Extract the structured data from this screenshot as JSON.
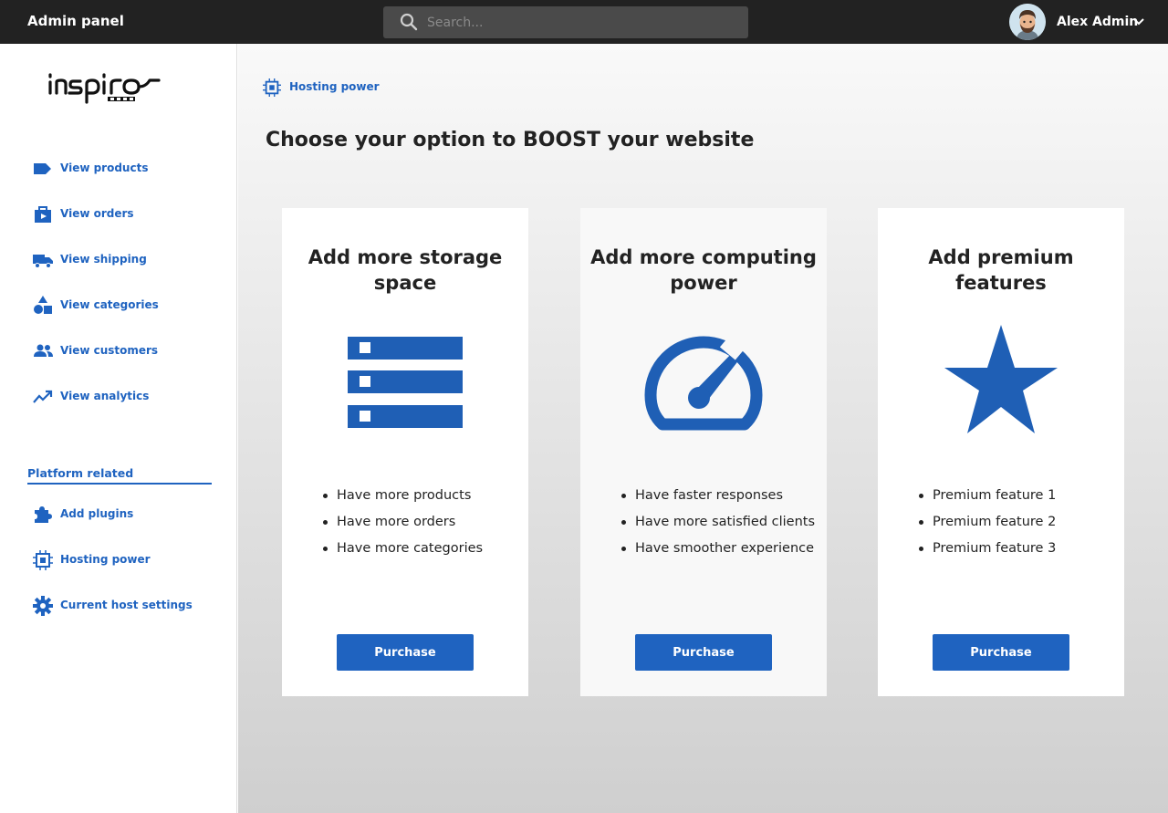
{
  "topbar": {
    "app_title": "Admin panel",
    "search_placeholder": "Search...",
    "user_name": "Alex Admin"
  },
  "sidebar": {
    "logo_icon": "inspiro-logo",
    "items": [
      {
        "label": "View products",
        "icon": "tag-icon"
      },
      {
        "label": "View orders",
        "icon": "bag-icon"
      },
      {
        "label": "View shipping",
        "icon": "truck-icon"
      },
      {
        "label": "View categories",
        "icon": "shapes-icon"
      },
      {
        "label": "View customers",
        "icon": "users-icon"
      },
      {
        "label": "View analytics",
        "icon": "trend-icon"
      }
    ],
    "section_title": "Platform related",
    "platform_items": [
      {
        "label": "Add plugins",
        "icon": "puzzle-icon"
      },
      {
        "label": "Hosting power",
        "icon": "chip-icon"
      },
      {
        "label": "Current host settings",
        "icon": "gear-icon"
      }
    ]
  },
  "main": {
    "breadcrumb": "Hosting power",
    "title": "Choose your option to BOOST your website",
    "cards": [
      {
        "title": "Add more storage space",
        "icon": "server-icon",
        "features": [
          "Have more products",
          "Have more orders",
          "Have more categories"
        ],
        "button": "Purchase",
        "bg": "#ffffff"
      },
      {
        "title": "Add more computing power",
        "icon": "speedometer-icon",
        "features": [
          "Have faster responses",
          "Have more satisfied clients",
          "Have smoother experience"
        ],
        "button": "Purchase",
        "bg": "#f8f8f8"
      },
      {
        "title": "Add premium features",
        "icon": "star-icon",
        "features": [
          "Premium feature 1",
          "Premium feature 2",
          "Premium feature 3"
        ],
        "button": "Purchase",
        "bg": "#ffffff"
      }
    ]
  },
  "colors": {
    "accent": "#1f63c0",
    "topbar": "#222222"
  }
}
